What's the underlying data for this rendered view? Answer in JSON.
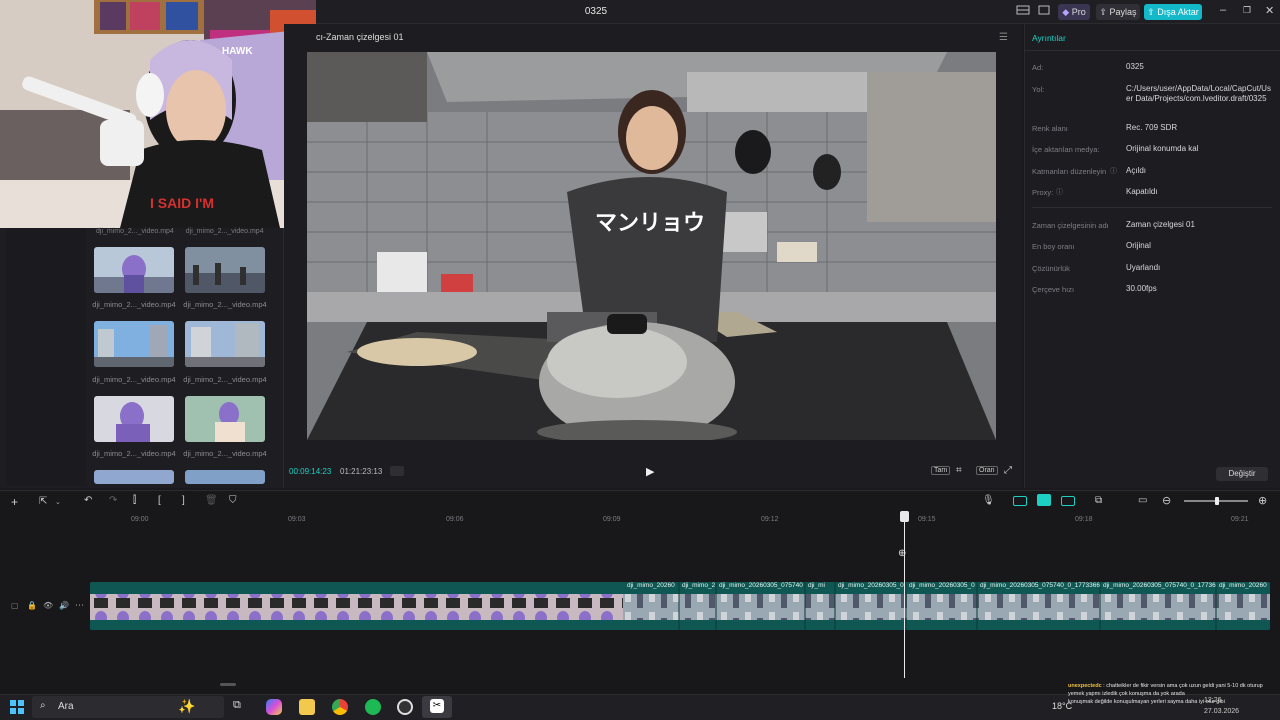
{
  "window": {
    "title": "0325",
    "pro_label": "Pro",
    "share_label": "Paylaş",
    "export_label": "Dışa Aktar"
  },
  "webcam": {
    "shirt_text": "I SAID I'M",
    "poster_text": "HAWK"
  },
  "media": {
    "thumbs": [
      {
        "label": "dji_mimo_2..._video.mp4"
      },
      {
        "label": "dji_mimo_2..._video.mp4"
      },
      {
        "label": "dji_mimo_2..._video.mp4"
      },
      {
        "label": "dji_mimo_2..._video.mp4"
      },
      {
        "label": "dji_mimo_2..._video.mp4"
      },
      {
        "label": "dji_mimo_2..._video.mp4"
      },
      {
        "label": "dji_mimo_2..._video.mp4"
      },
      {
        "label": "dji_mimo_2..._video.mp4"
      }
    ]
  },
  "player": {
    "title": "cı-Zaman çizelgesi 01",
    "current_time": "00:09:14:23",
    "total_time": "01:21:23:13",
    "btn_full": "Tam",
    "btn_ratio": "Oran",
    "apron_text": "マンリョウ"
  },
  "details": {
    "header": "Ayrıntılar",
    "rows1": [
      {
        "label": "Ad:",
        "value": "0325"
      },
      {
        "label": "Yol:",
        "value": "C:/Users/user/AppData/Local/CapCut/User Data/Projects/com.lveditor.draft/0325"
      },
      {
        "label": "Renk alanı",
        "value": "Rec. 709 SDR"
      },
      {
        "label": "İçe aktarılan medya:",
        "value": "Orijinal konumda kal"
      },
      {
        "label": "Katmanları düzenleyin",
        "value": "Açıldı"
      },
      {
        "label": "Proxy:",
        "value": "Kapatıldı"
      }
    ],
    "rows2": [
      {
        "label": "Zaman çizelgesinin adı",
        "value": "Zaman çizelgesi 01"
      },
      {
        "label": "En boy oranı",
        "value": "Orijinal"
      },
      {
        "label": "Çözünürlük",
        "value": "Uyarlandı"
      },
      {
        "label": "Çerçeve hızı",
        "value": "30.00fps"
      }
    ],
    "change_button": "Değiştir"
  },
  "timeline": {
    "ticks": [
      "09:00",
      "09:03",
      "09:06",
      "09:09",
      "09:12",
      "09:15",
      "09:18",
      "09:21"
    ],
    "segments": [
      "dji_mimo_20260",
      "dji_mimo_2",
      "dji_mimo_20260305_075740",
      "dji_mi",
      "dji_mimo_20260305_0",
      "dji_mimo_20260305_0",
      "dji_mimo_20260305_075740_0_1773366",
      "dji_mimo_20260305_075740_0_17736",
      "dji_mimo_20260"
    ]
  },
  "taskbar": {
    "search_placeholder": "Ara",
    "temperature": "18°C",
    "time": "12:26",
    "date": "27.03.2026"
  },
  "chat": {
    "user": "unexpectedc",
    "message": ": chatteikler de fikir versin ama çok uzun geldi yani 5-10 dk oturup yemek yapmı izledik çok konuşma da yok arada",
    "line2": "konuşmak değilde konuşulmayan yerleri sayma daha iyi olur gibi"
  },
  "colors": {
    "accent": "#1ed0c3",
    "export": "#13b8c9",
    "track": "#0f5752"
  }
}
